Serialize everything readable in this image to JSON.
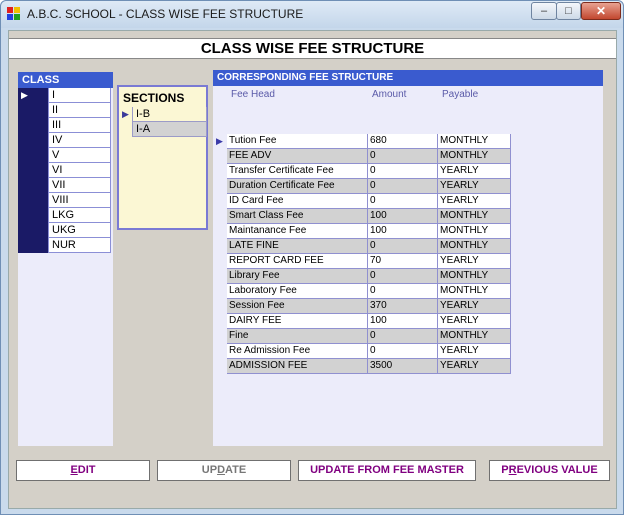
{
  "window": {
    "title": "A.B.C. SCHOOL - CLASS WISE FEE STRUCTURE",
    "min": "–",
    "max": "□",
    "close": "✕"
  },
  "header": {
    "title": "CLASS WISE FEE STRUCTURE"
  },
  "class_panel": {
    "title": "CLASS",
    "items": [
      "I",
      "II",
      "III",
      "IV",
      "V",
      "VI",
      "VII",
      "VIII",
      "LKG",
      "UKG",
      "NUR"
    ],
    "selected_index": 0
  },
  "sections_panel": {
    "title": "SECTIONS",
    "items": [
      "I-B",
      "I-A"
    ],
    "selected_index": 0
  },
  "fee_panel": {
    "title": "CORRESPONDING FEE STRUCTURE",
    "columns": [
      "Fee Head",
      "Amount",
      "Payable"
    ],
    "rows": [
      [
        "Tution Fee",
        "680",
        "MONTHLY"
      ],
      [
        "FEE ADV",
        "0",
        "MONTHLY"
      ],
      [
        "Transfer Certificate Fee",
        "0",
        "YEARLY"
      ],
      [
        "Duration Certificate Fee",
        "0",
        "YEARLY"
      ],
      [
        "ID Card Fee",
        "0",
        "YEARLY"
      ],
      [
        "Smart Class Fee",
        "100",
        "MONTHLY"
      ],
      [
        "Maintanance Fee",
        "100",
        "MONTHLY"
      ],
      [
        "LATE FINE",
        "0",
        "MONTHLY"
      ],
      [
        "REPORT CARD FEE",
        "70",
        "YEARLY"
      ],
      [
        "Library Fee",
        "0",
        "MONTHLY"
      ],
      [
        "Laboratory Fee",
        "0",
        "MONTHLY"
      ],
      [
        "Session Fee",
        "370",
        "YEARLY"
      ],
      [
        "DAIRY FEE",
        "100",
        "YEARLY"
      ],
      [
        "Fine",
        "0",
        "MONTHLY"
      ],
      [
        "Re Admission Fee",
        "0",
        "YEARLY"
      ],
      [
        "ADMISSION FEE",
        "3500",
        "YEARLY"
      ]
    ],
    "selected_index": 0
  },
  "buttons": {
    "edit": {
      "first": "E",
      "rest": "DIT"
    },
    "update": {
      "first": "UP",
      "u": "D",
      "rest": "ATE"
    },
    "update_master": "UPDATE FROM FEE MASTER",
    "previous": {
      "first": "P",
      "u": "R",
      "rest": "EVIOUS VALUE"
    }
  },
  "selector_glyph": "▶"
}
